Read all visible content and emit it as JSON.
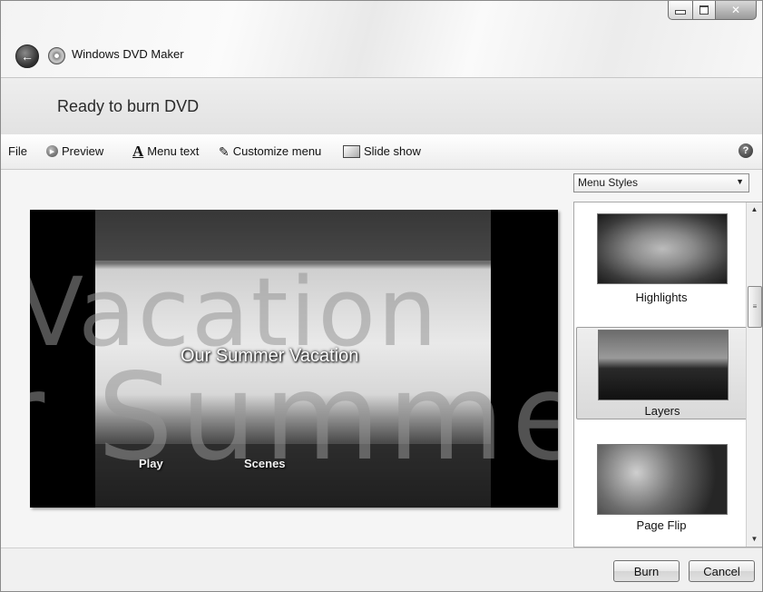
{
  "window": {
    "title": "Windows DVD Maker",
    "icons": {
      "back": "back-arrow-icon",
      "app": "dvd-disc-icon",
      "minimize": "minimize-icon",
      "maximize": "maximize-icon",
      "close": "close-icon"
    }
  },
  "header": {
    "title": "Ready to burn DVD"
  },
  "toolbar": {
    "file_label": "File",
    "preview_label": "Preview",
    "menu_text_label": "Menu text",
    "customize_menu_label": "Customize menu",
    "slide_show_label": "Slide show",
    "help_icon": "help-icon"
  },
  "preview": {
    "watermark_top": "Vacation",
    "watermark_bottom": "r Summe",
    "menu_title": "Our Summer Vacation",
    "play_label": "Play",
    "scenes_label": "Scenes"
  },
  "menu_styles": {
    "selected": "Menu Styles",
    "items": [
      {
        "label": "Highlights",
        "selected": false
      },
      {
        "label": "Layers",
        "selected": true
      },
      {
        "label": "Page Flip",
        "selected": false
      }
    ]
  },
  "footer": {
    "burn_label": "Burn",
    "cancel_label": "Cancel"
  },
  "colors": {
    "window_bg": "#f4f4f4",
    "preview_bg": "#000000",
    "selection_bg": "#d9d9d9"
  }
}
